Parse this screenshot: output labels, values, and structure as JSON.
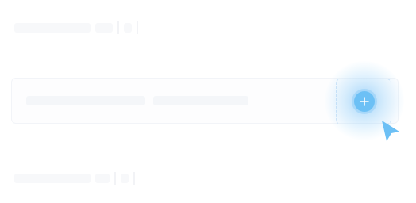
{
  "canvas": {
    "background": "#ffffff"
  },
  "placeholder_rows": {
    "top": {
      "bar_color": "#f7f8fa"
    },
    "middle": {
      "bar_color": "#f4f6f9"
    },
    "bottom": {
      "bar_color": "#f7f8fa"
    }
  },
  "add_action": {
    "icon": "plus-icon",
    "accent": "#6cc0f5",
    "glow": "#5ab4f5"
  },
  "pointer": {
    "icon": "cursor-arrow-icon",
    "color": "#6cc0f5"
  }
}
